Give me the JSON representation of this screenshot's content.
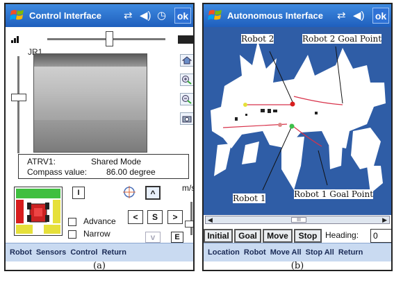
{
  "panel_a": {
    "title": "Control Interface",
    "ok_label": "ok",
    "camera_label": "JR1",
    "status": {
      "robot_label": "ATRV1:",
      "mode": "Shared Mode",
      "compass_label": "Compass value:",
      "compass_value": "86.00 degree"
    },
    "buttons": {
      "i": "I",
      "up": "^",
      "left": "<",
      "stop": "S",
      "right": ">",
      "down": "v",
      "e": "E"
    },
    "checkboxes": [
      {
        "label": "Advance",
        "checked": false
      },
      {
        "label": "Narrow",
        "checked": false
      }
    ],
    "speed_unit": "m/s",
    "menu": [
      "Robot",
      "Sensors",
      "Control",
      "Return"
    ],
    "caption": "(a)"
  },
  "panel_b": {
    "title": "Autonomous Interface",
    "ok_label": "ok",
    "map_labels": {
      "robot2": "Robot 2",
      "robot2_goal": "Robot 2 Goal Point",
      "robot1": "Robot 1",
      "robot1_goal": "Robot 1 Goal Point"
    },
    "scroll_thumb": "III",
    "buttons": [
      "Initial",
      "Goal",
      "Move",
      "Stop"
    ],
    "heading_label": "Heading:",
    "heading_value": "0",
    "menu": [
      "Location",
      "Robot",
      "Move All",
      "Stop All",
      "Return"
    ],
    "caption": "(b)"
  },
  "colors": {
    "titlebar": "#2a6fd0",
    "menubar": "#c9daf1",
    "map_background": "#2f5da6",
    "robot1_marker": "#3cc14a",
    "robot2_marker": "#d81e1e",
    "path": "#d8324a"
  },
  "icons": [
    "windows-logo-icon",
    "connectivity-icon",
    "volume-icon",
    "clock-icon",
    "signal-icon",
    "battery-icon",
    "home-icon",
    "zoom-in-icon",
    "zoom-out-icon",
    "camera-icon",
    "compass-icon"
  ]
}
